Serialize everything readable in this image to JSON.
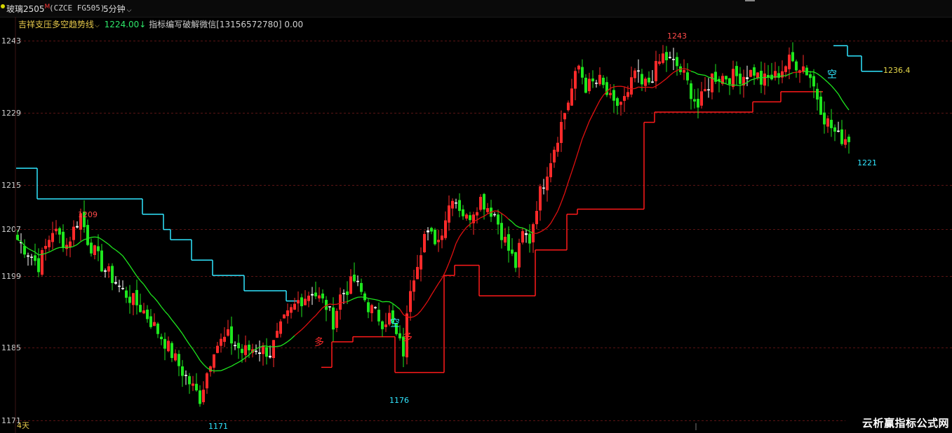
{
  "header": {
    "symbol_name": "玻璃2505",
    "symbol_marker": "M",
    "contract_code": "(CZCE FG505)",
    "period_label": "5分钟",
    "period_chevron": "⌵"
  },
  "indicator_legend": {
    "name": "吉祥支压多空趋势线",
    "chevron": "⌵",
    "value": "1224.00↓",
    "description": "指标编写破解微信[13156572780]",
    "extra_value": "0.00"
  },
  "watermark_text": "云析赢指标公式网",
  "colors": {
    "up": "#ff2a2a",
    "down": "#1ee61e",
    "doji": "#ffffff",
    "ma_red": "#e01010",
    "ma_green": "#1ee61e",
    "support": "#ff1a1a",
    "resistance": "#31e6ff",
    "grid": "#5a1414"
  },
  "chart_data": {
    "type": "candlestick",
    "y_axis_ticks": [
      "1243",
      "1229",
      "1215",
      "1207",
      "1199",
      "1185",
      "1171"
    ],
    "x_axis_label": "4天",
    "annotations": {
      "high_left": "1209",
      "high_main": "1243",
      "low_left": "1171",
      "low_mid": "1176",
      "low_right": "1221",
      "last_level": "1236.4"
    },
    "signals": [
      {
        "text": "多",
        "color": "#ff2a2a"
      },
      {
        "text": "空",
        "color": "#31e6ff"
      },
      {
        "text": "多",
        "color": "#ff2a2a"
      },
      {
        "text": "空",
        "color": "#31e6ff"
      }
    ],
    "anchors": [
      [
        0,
        1204
      ],
      [
        6,
        1199
      ],
      [
        10,
        1206
      ],
      [
        14,
        1203
      ],
      [
        18,
        1209
      ],
      [
        20,
        1204
      ],
      [
        24,
        1199
      ],
      [
        30,
        1194
      ],
      [
        36,
        1190
      ],
      [
        42,
        1184
      ],
      [
        48,
        1177
      ],
      [
        52,
        1173
      ],
      [
        56,
        1183
      ],
      [
        60,
        1185
      ],
      [
        64,
        1182
      ],
      [
        68,
        1183
      ],
      [
        72,
        1182
      ],
      [
        76,
        1188
      ],
      [
        80,
        1192
      ],
      [
        84,
        1194
      ],
      [
        88,
        1191
      ],
      [
        90,
        1188
      ],
      [
        92,
        1193
      ],
      [
        96,
        1196
      ],
      [
        100,
        1191
      ],
      [
        104,
        1188
      ],
      [
        106,
        1189
      ],
      [
        108,
        1185
      ],
      [
        110,
        1182
      ],
      [
        112,
        1195
      ],
      [
        116,
        1205
      ],
      [
        120,
        1204
      ],
      [
        124,
        1213
      ],
      [
        128,
        1208
      ],
      [
        132,
        1212
      ],
      [
        136,
        1209
      ],
      [
        140,
        1202
      ],
      [
        142,
        1199
      ],
      [
        144,
        1205
      ],
      [
        146,
        1204
      ],
      [
        148,
        1211
      ],
      [
        152,
        1220
      ],
      [
        156,
        1229
      ],
      [
        160,
        1238
      ],
      [
        162,
        1234
      ],
      [
        166,
        1235
      ],
      [
        170,
        1230
      ],
      [
        174,
        1232
      ],
      [
        176,
        1237
      ],
      [
        178,
        1234
      ],
      [
        180,
        1235
      ],
      [
        184,
        1240
      ],
      [
        188,
        1238
      ],
      [
        190,
        1236
      ],
      [
        194,
        1230
      ],
      [
        198,
        1236
      ],
      [
        202,
        1236
      ],
      [
        206,
        1236
      ],
      [
        210,
        1237
      ],
      [
        212,
        1235
      ],
      [
        216,
        1236
      ],
      [
        220,
        1239
      ],
      [
        224,
        1238
      ],
      [
        226,
        1236
      ],
      [
        228,
        1232
      ],
      [
        230,
        1228
      ],
      [
        232,
        1226
      ],
      [
        234,
        1224
      ],
      [
        236,
        1224
      ]
    ]
  }
}
